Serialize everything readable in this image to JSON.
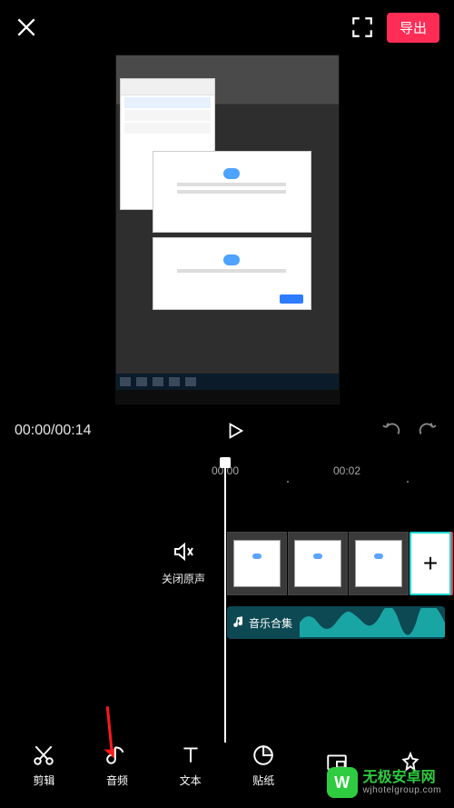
{
  "top": {
    "export_label": "导出"
  },
  "playback": {
    "current": "00:00",
    "total": "00:14"
  },
  "ruler": {
    "t1": "00:00",
    "t2": "00:02"
  },
  "mute": {
    "label": "关闭原声"
  },
  "add_clip": {
    "symbol": "+"
  },
  "audio_track": {
    "label": "音乐合集"
  },
  "toolbar": {
    "items": [
      {
        "id": "cut",
        "label": "剪辑"
      },
      {
        "id": "audio",
        "label": "音频"
      },
      {
        "id": "text",
        "label": "文本"
      },
      {
        "id": "sticker",
        "label": "贴纸"
      },
      {
        "id": "pip",
        "label": ""
      },
      {
        "id": "effect",
        "label": ""
      }
    ]
  },
  "watermark": {
    "badge": "W",
    "line1": "无极安卓网",
    "line2": "wjhotelgroup.com"
  }
}
